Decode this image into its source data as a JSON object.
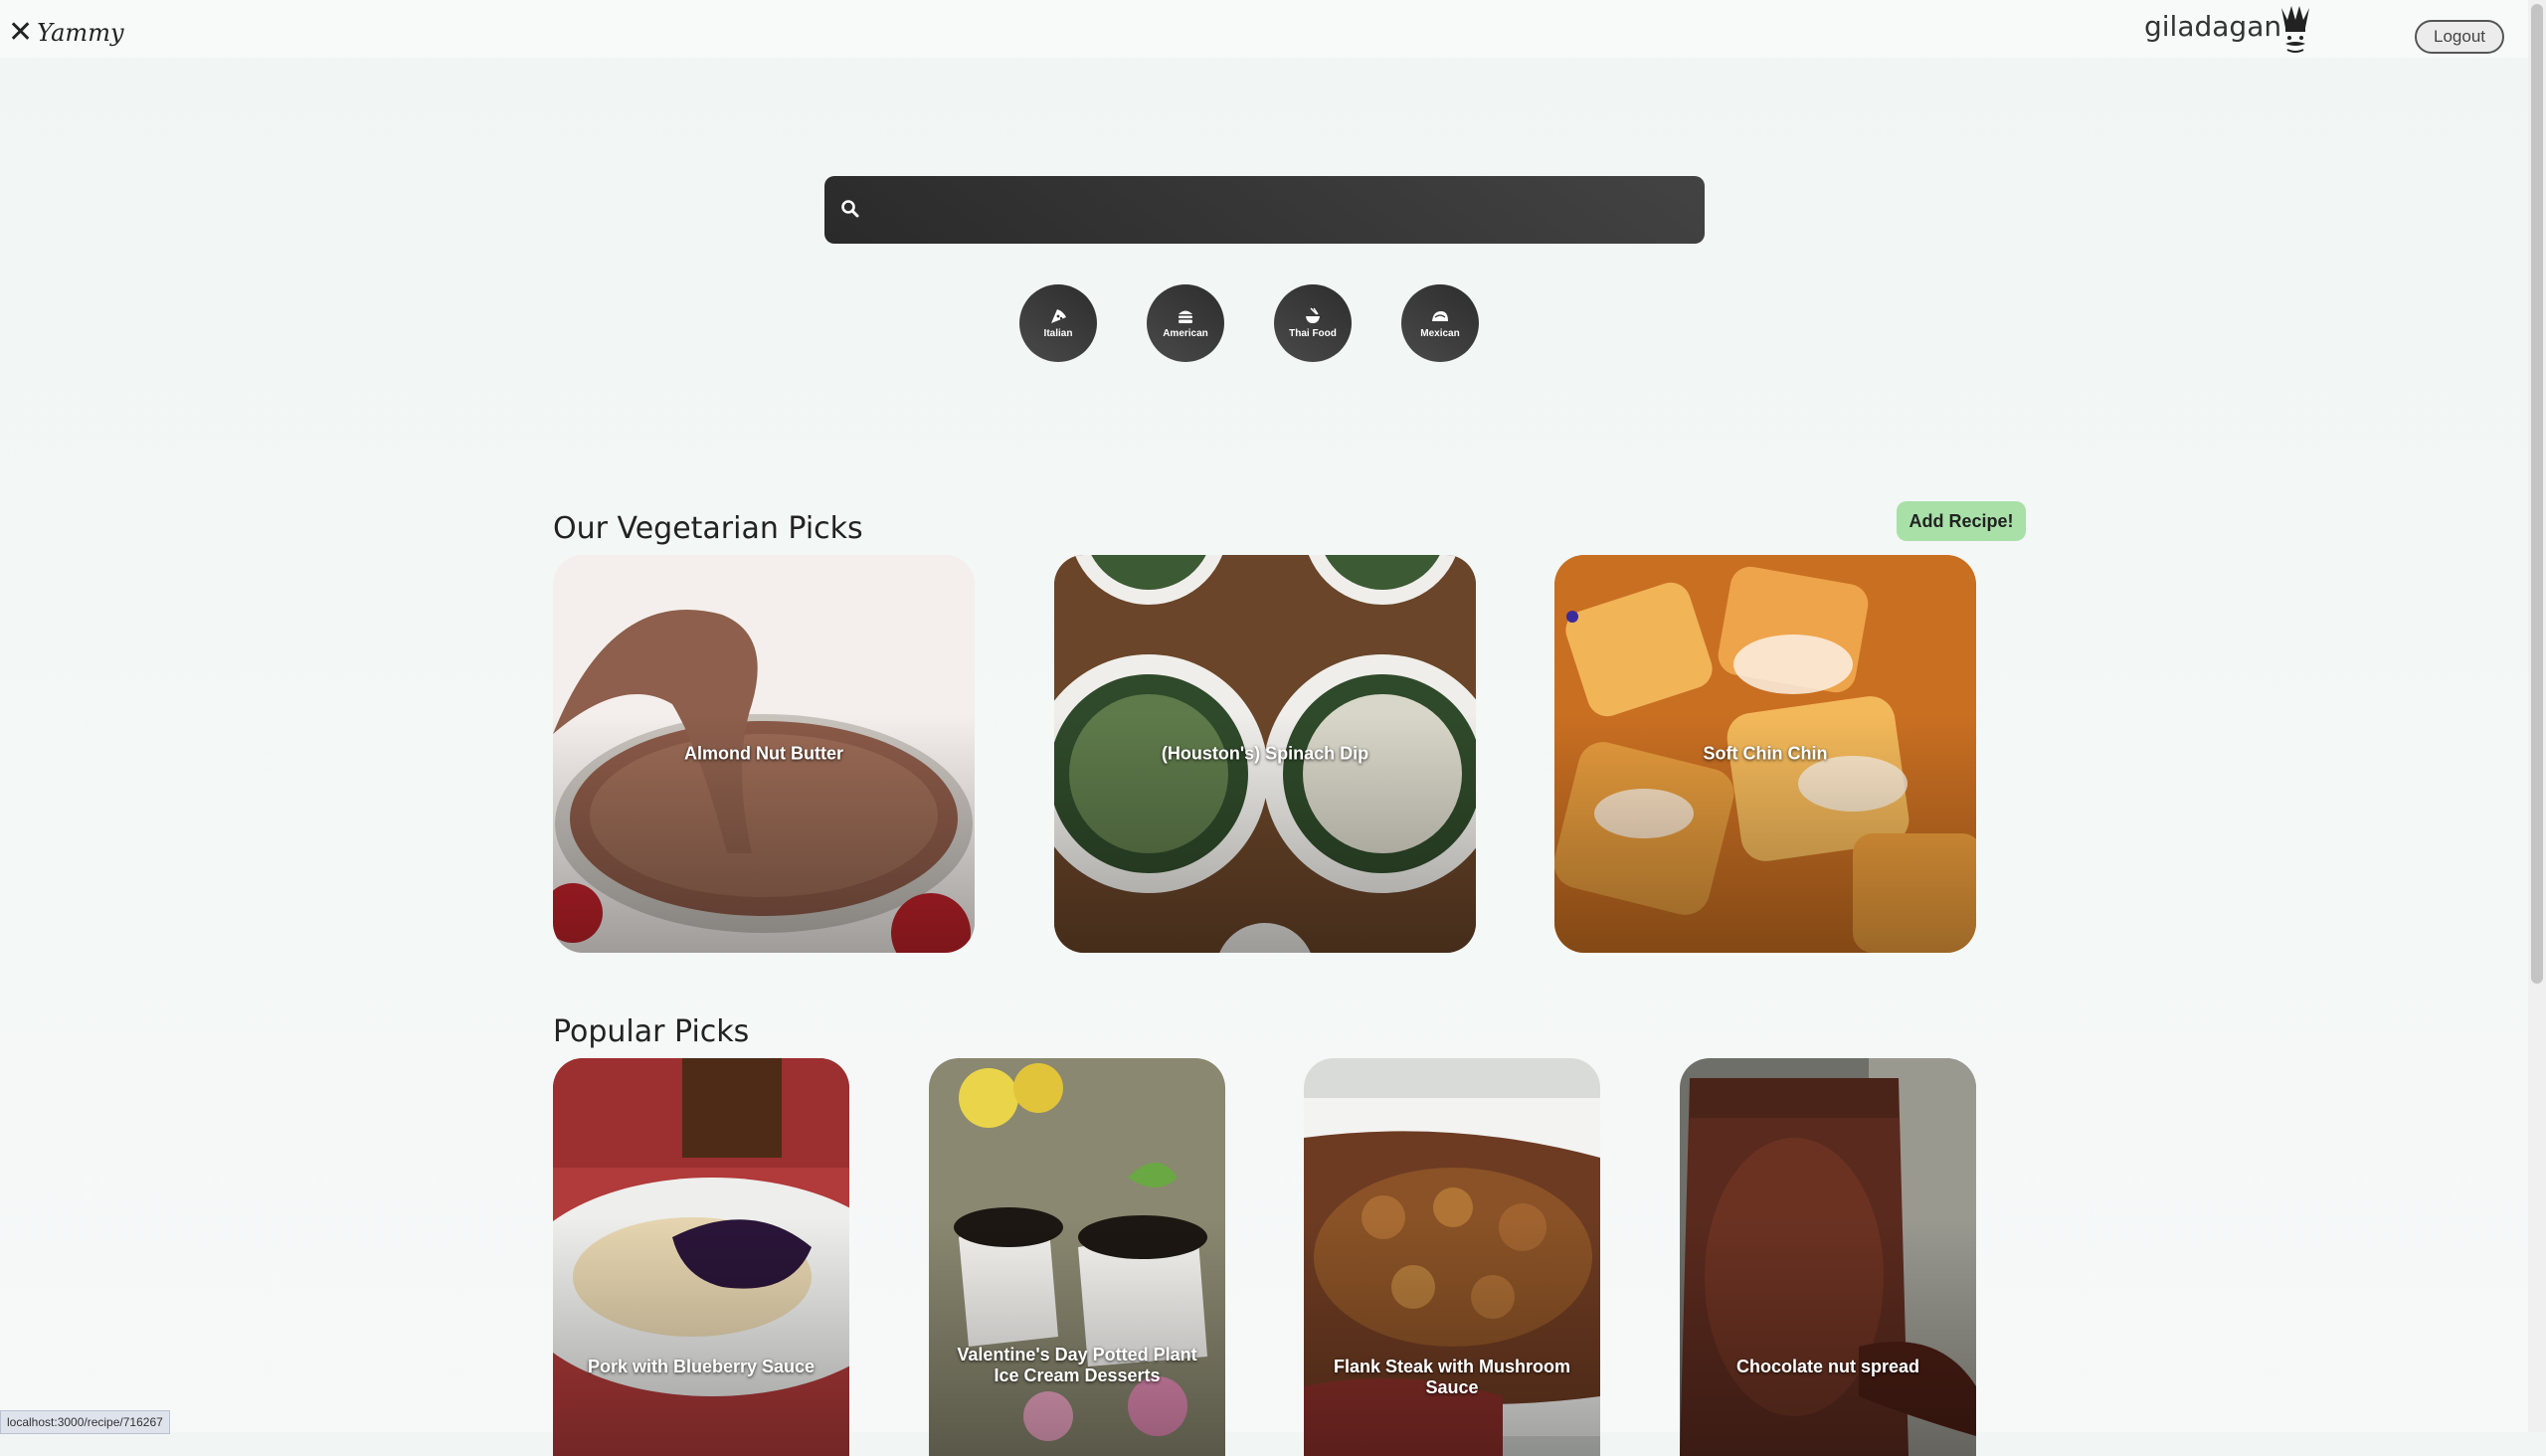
{
  "header": {
    "logo_text": "Yammy",
    "username": "giladagan",
    "logout_label": "Logout"
  },
  "search": {
    "placeholder": "",
    "value": ""
  },
  "cuisines": [
    {
      "label": "Italian",
      "icon": "pizza-icon"
    },
    {
      "label": "American",
      "icon": "hamburger-icon"
    },
    {
      "label": "Thai Food",
      "icon": "noodle-bowl-icon"
    },
    {
      "label": "Mexican",
      "icon": "taco-icon"
    }
  ],
  "veggie": {
    "title": "Our Vegetarian Picks",
    "add_recipe_label": "Add Recipe!",
    "cards": [
      {
        "title": "Almond Nut Butter"
      },
      {
        "title": "(Houston's) Spinach Dip"
      },
      {
        "title": "Soft Chin Chin"
      }
    ]
  },
  "popular": {
    "title": "Popular Picks",
    "cards": [
      {
        "title": "Pork with Blueberry Sauce"
      },
      {
        "title": "Valentine's Day Potted Plant Ice Cream Desserts"
      },
      {
        "title": "Flank Steak with Mushroom Sauce"
      },
      {
        "title": "Chocolate nut spread"
      }
    ]
  },
  "status_bar": {
    "url": "localhost:3000/recipe/716267"
  }
}
